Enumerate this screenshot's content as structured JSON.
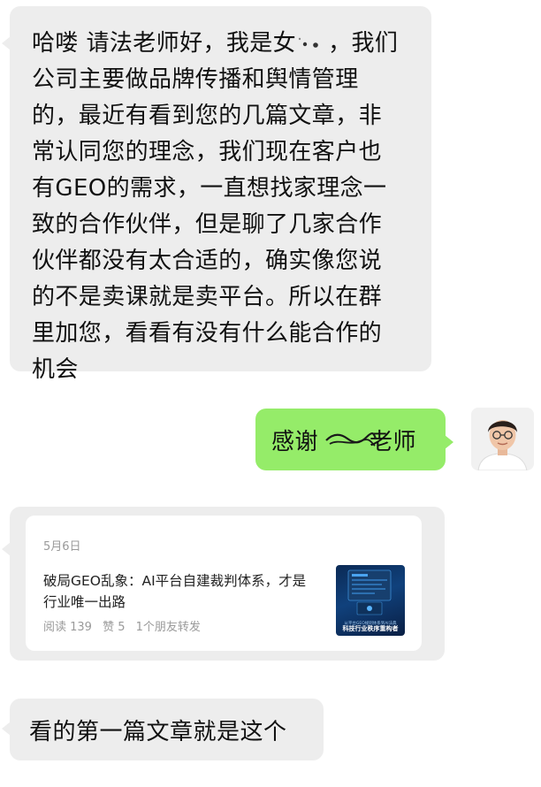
{
  "messages": {
    "first": {
      "lines": [
        "哈喽 请法老师好，我是女",
        "公司主要做品牌传播和舆情管理",
        "的，最近有看到您的几篇文章，非",
        "常认同您的理念，我们现在客户也",
        "有GEO的需求，一直想找家理念一",
        "致的合作伙伴，但是聊了几家合作",
        "伙伴都没有太合适的，确实像您说",
        "的不是卖课就是卖平台。所以在群",
        "里加您，看看有没有什么能合作的",
        "机会"
      ],
      "line1_tail": "，我们"
    },
    "reply": {
      "prefix": "感谢",
      "suffix": "老师"
    },
    "article_card": {
      "date": "5月6日",
      "title": "破局GEO乱象：AI平台自建裁判体系，才是行业唯一出路",
      "reads": "阅读 139",
      "likes": "赞 5",
      "shares": "1个朋友转发",
      "thumb_caption_small": "从平台GEO规则体系到AI法典",
      "thumb_caption_big": "科技行业秩序重构者"
    },
    "last": {
      "text": "看的第一篇文章就是这个"
    }
  },
  "colors": {
    "incoming_bubble": "#ededed",
    "outgoing_bubble": "#95ec69",
    "meta_text": "#9a9a9a"
  }
}
